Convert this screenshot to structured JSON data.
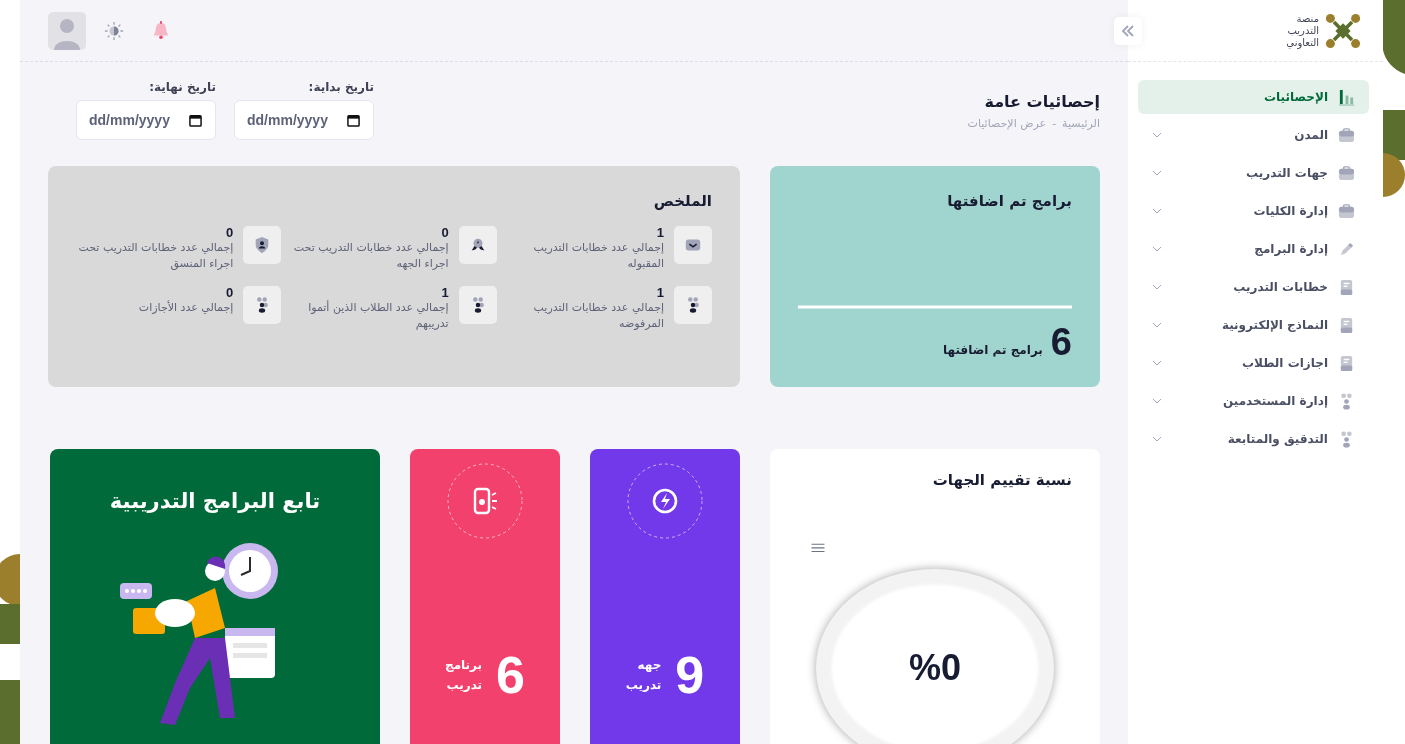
{
  "sidebar": {
    "logo_text": "منصة\nالتدريب\nالتعاوني",
    "items": [
      {
        "label": "الإحصائيات",
        "kind": "chart",
        "selected": true,
        "has_submenu": false
      },
      {
        "label": "المدن",
        "kind": "briefcase",
        "selected": false,
        "has_submenu": true
      },
      {
        "label": "جهات التدريب",
        "kind": "briefcase",
        "selected": false,
        "has_submenu": true
      },
      {
        "label": "إدارة الكليات",
        "kind": "briefcase",
        "selected": false,
        "has_submenu": true
      },
      {
        "label": "إدارة البرامج",
        "kind": "pen",
        "selected": false,
        "has_submenu": true
      },
      {
        "label": "خطابات التدريب",
        "kind": "document",
        "selected": false,
        "has_submenu": true
      },
      {
        "label": "النماذج الإلكترونية",
        "kind": "document",
        "selected": false,
        "has_submenu": true
      },
      {
        "label": "اجازات الطلاب",
        "kind": "document",
        "selected": false,
        "has_submenu": true
      },
      {
        "label": "إدارة المستخدمين",
        "kind": "users",
        "selected": false,
        "has_submenu": true
      },
      {
        "label": "التدقيق والمتابعة",
        "kind": "users",
        "selected": false,
        "has_submenu": true
      }
    ]
  },
  "page": {
    "title": "إحصائيات عامة",
    "breadcrumb": [
      "الرئيسية",
      "عرض الإحصائيات"
    ],
    "breadcrumb_separator": "-"
  },
  "date_filters": [
    {
      "label": "تاريخ بداية:",
      "placeholder": "dd/mm/yyyy"
    },
    {
      "label": "تاريخ نهاية:",
      "placeholder": "dd/mm/yyyy"
    }
  ],
  "programs_card": {
    "title": "برامج تم اضافتها",
    "value": "6",
    "caption": "برامج تم اضافتها"
  },
  "summary": {
    "title": "الملخص",
    "items": [
      {
        "value": "1",
        "label": "إجمالي عدد خطابات التدريب المقبوله",
        "kind": "inbox"
      },
      {
        "value": "0",
        "label": "إجمالي عدد خطابات التدريب تحت اجراء الجهه",
        "kind": "award"
      },
      {
        "value": "0",
        "label": "إجمالي عدد خطابات التدريب تحت اجراء المنسق",
        "kind": "shield"
      },
      {
        "value": "1",
        "label": "إجمالي عدد خطابات التدريب المرفوضه",
        "kind": "users"
      },
      {
        "value": "1",
        "label": "إجمالي عدد الطلاب الذين أتموا تدريبهم",
        "kind": "users"
      },
      {
        "value": "0",
        "label": "إجمالي عدد الأجازات",
        "kind": "users"
      }
    ]
  },
  "rating_card": {
    "title": "نسبة تقييم الجهات",
    "value": "%0"
  },
  "stat_cards": [
    {
      "value": "9",
      "label": "جهه\nتدريب",
      "kind": "bolt",
      "color": "#7239ea"
    },
    {
      "value": "6",
      "label": "برنامج\nتدريب",
      "kind": "phone",
      "color": "#f1416c"
    }
  ],
  "promo_card": {
    "title": "تابع البرامج التدريبية"
  }
}
